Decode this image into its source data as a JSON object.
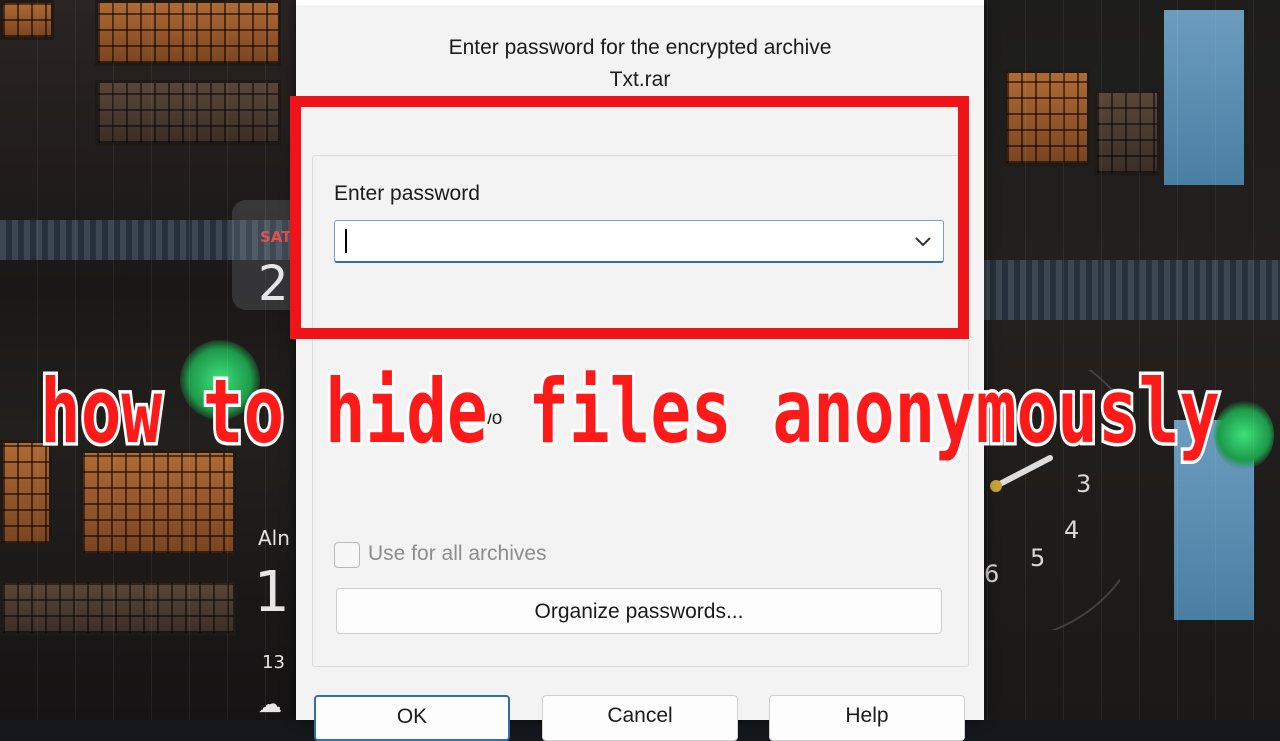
{
  "dialog": {
    "heading": "Enter password for the encrypted archive",
    "archive_name": "Txt.rar",
    "password_label": "Enter password",
    "password_value": "",
    "partial_hidden_text": "wo",
    "use_for_all_label": "Use for all archives",
    "use_for_all_checked": false,
    "organize_button": "Organize passwords...",
    "ok_button": "OK",
    "cancel_button": "Cancel",
    "help_button": "Help"
  },
  "overlay": {
    "headline": "how to hide files anonymously",
    "headline_color": "#ff1a1a",
    "highlight_box_color": "#f0141a"
  },
  "lockscreen": {
    "day": "SAT",
    "date_partial": "2",
    "alarm_partial": "Aln",
    "time_partial": "1",
    "weather_partial": "13"
  },
  "clock_numbers": [
    "3",
    "4",
    "5",
    "6"
  ],
  "colors": {
    "dialog_bg": "#f3f3f3",
    "accent": "#2f6fb0"
  }
}
